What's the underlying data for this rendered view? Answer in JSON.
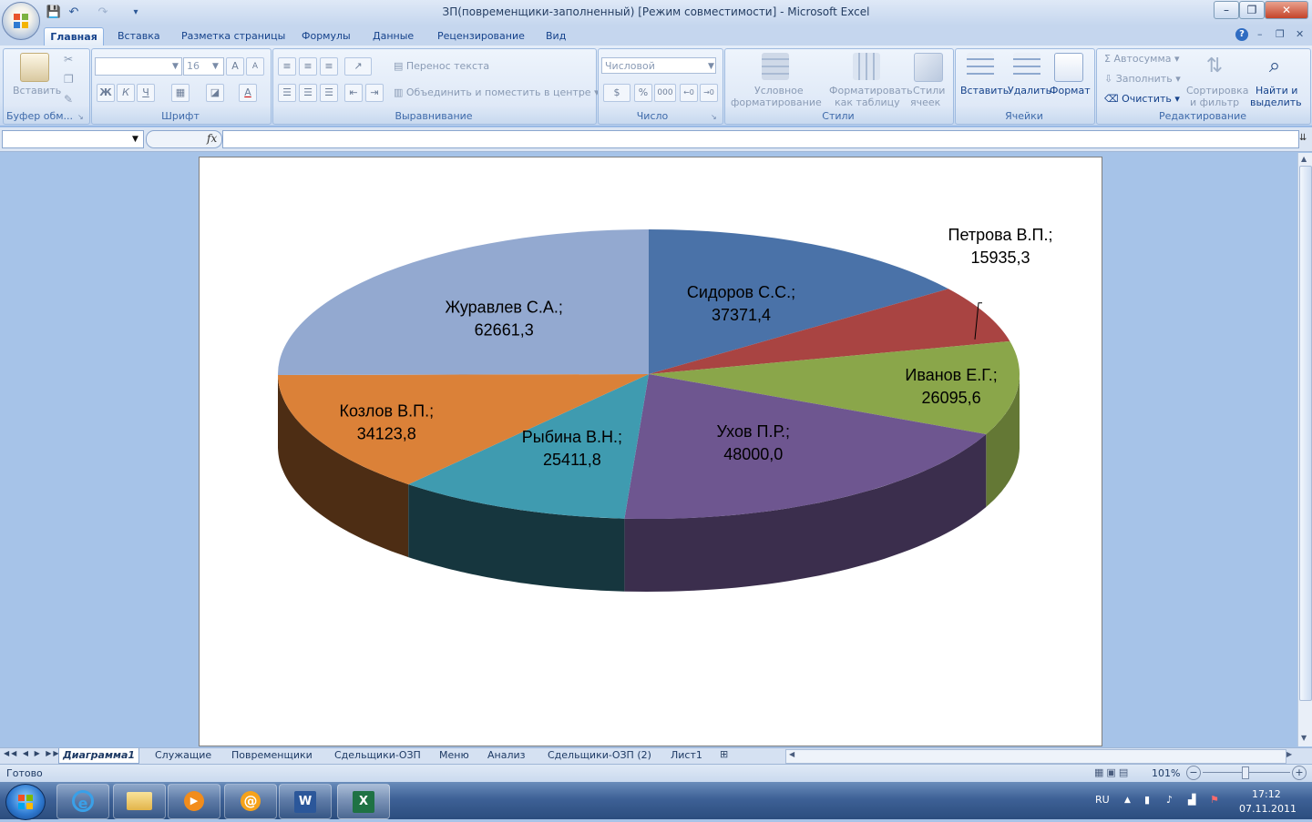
{
  "window": {
    "title": "ЗП(повременщики-заполненный)  [Режим совместимости] - Microsoft Excel",
    "controls": {
      "minimize": "–",
      "restore": "❐",
      "close": "✕"
    },
    "ribbon_controls": {
      "minimize": "–",
      "restore": "❐",
      "close": "✕"
    }
  },
  "quick_access": {
    "save": "💾",
    "undo": "↶",
    "redo": "↷",
    "customize": "▾"
  },
  "ribbon": {
    "tabs": [
      "Главная",
      "Вставка",
      "Разметка страницы",
      "Формулы",
      "Данные",
      "Рецензирование",
      "Вид"
    ],
    "active_tab": "Главная",
    "help": "?",
    "clipboard": {
      "paste": "Вставить",
      "label": "Буфер обм..."
    },
    "font": {
      "name": "",
      "size": "16",
      "grow": "A",
      "shrink": "A",
      "bold": "Ж",
      "italic": "К",
      "underline": "Ч",
      "label": "Шрифт"
    },
    "alignment": {
      "wrap": "Перенос текста",
      "merge": "Объединить и поместить в центре",
      "label": "Выравнивание"
    },
    "number": {
      "format": "Числовой",
      "percent": "%",
      "thousands": "000",
      "label": "Число"
    },
    "styles": {
      "conditional_1": "Условное",
      "conditional_2": "форматирование",
      "table_1": "Форматировать",
      "table_2": "как таблицу",
      "cell_1": "Стили",
      "cell_2": "ячеек",
      "label": "Стили"
    },
    "cells": {
      "insert": "Вставить",
      "delete": "Удалить",
      "format": "Формат",
      "label": "Ячейки"
    },
    "editing": {
      "autosum": "Автосумма",
      "fill": "Заполнить",
      "clear": "Очистить",
      "sort_1": "Сортировка",
      "sort_2": "и фильтр",
      "find_1": "Найти и",
      "find_2": "выделить",
      "label": "Редактирование"
    }
  },
  "formula_bar": {
    "name_box": "",
    "fx": "fx",
    "content": ""
  },
  "chart_data": {
    "type": "pie",
    "style": "3d",
    "title": "",
    "categories": [
      "Сидоров С.С.",
      "Петрова В.П.",
      "Иванов Е.Г.",
      "Ухов П.Р.",
      "Рыбина В.Н.",
      "Козлов В.П.",
      "Журавлев С.А."
    ],
    "values": [
      37371.4,
      15935.3,
      26095.6,
      48000.0,
      25411.8,
      34123.8,
      62661.3
    ],
    "labels": [
      {
        "name": "Сидоров С.С.;",
        "value": "37371,4"
      },
      {
        "name": "Петрова В.П.;",
        "value": "15935,3"
      },
      {
        "name": "Иванов Е.Г.;",
        "value": "26095,6"
      },
      {
        "name": "Ухов П.Р.;",
        "value": "48000,0"
      },
      {
        "name": "Рыбина В.Н.;",
        "value": "25411,8"
      },
      {
        "name": "Козлов В.П.;",
        "value": "34123,8"
      },
      {
        "name": "Журавлев С.А.;",
        "value": "62661,3"
      }
    ],
    "colors": [
      "#4a72a8",
      "#a94442",
      "#8aa64a",
      "#6e5690",
      "#3f9bb0",
      "#db8138",
      "#93a9d0"
    ],
    "legend": "none"
  },
  "sheets": {
    "nav": [
      "◀◀",
      "◀",
      "▶",
      "▶▶"
    ],
    "tabs": [
      "Диаграмма1",
      "Служащие",
      "Повременщики",
      "Сдельщики-ОЗП",
      "Меню",
      "Анализ",
      "Сдельщики-ОЗП (2)",
      "Лист1"
    ],
    "active": "Диаграмма1"
  },
  "status": {
    "ready": "Готово",
    "zoom": "101%",
    "zoom_out": "−",
    "zoom_in": "+"
  },
  "taskbar": {
    "lang": "RU",
    "time": "17:12",
    "date": "07.11.2011"
  }
}
